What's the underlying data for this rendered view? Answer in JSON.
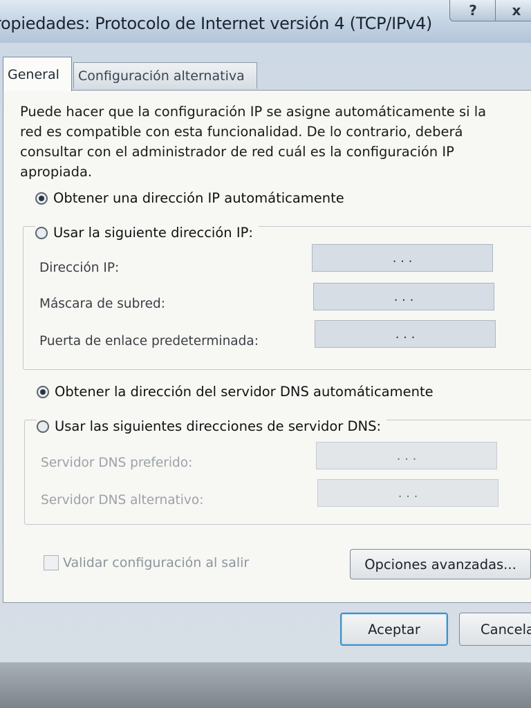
{
  "window": {
    "title": "ropiedades: Protocolo de Internet versión 4 (TCP/IPv4)",
    "help_label": "?",
    "close_label": "x"
  },
  "tabs": [
    {
      "label": "General",
      "active": true
    },
    {
      "label": "Configuración alternativa",
      "active": false
    }
  ],
  "general": {
    "intro_text": "Puede hacer que la configuración IP se asigne automáticamente si la red es compatible con esta funcionalidad. De lo contrario, deberá consultar con el administrador de red cuál es la configuración IP apropiada.",
    "ip_auto_label": "Obtener una dirección IP automáticamente",
    "ip_manual_label": "Usar la siguiente dirección IP:",
    "ip_fields": [
      {
        "label": "Dirección IP:",
        "value": ".          .          ."
      },
      {
        "label": "Máscara de subred:",
        "value": ".          .          ."
      },
      {
        "label": "Puerta de enlace predeterminada:",
        "value": ".          .          ."
      }
    ],
    "dns_auto_label": "Obtener la dirección del servidor DNS automáticamente",
    "dns_manual_label": "Usar las siguientes direcciones de servidor DNS:",
    "dns_fields": [
      {
        "label": "Servidor DNS preferido:",
        "value": ".          .          ."
      },
      {
        "label": "Servidor DNS alternativo:",
        "value": ".          .          ."
      }
    ],
    "validate_label": "Validar configuración al salir",
    "advanced_button": "Opciones avanzadas..."
  },
  "footer": {
    "ok_button": "Aceptar",
    "cancel_button": "Cancela"
  }
}
